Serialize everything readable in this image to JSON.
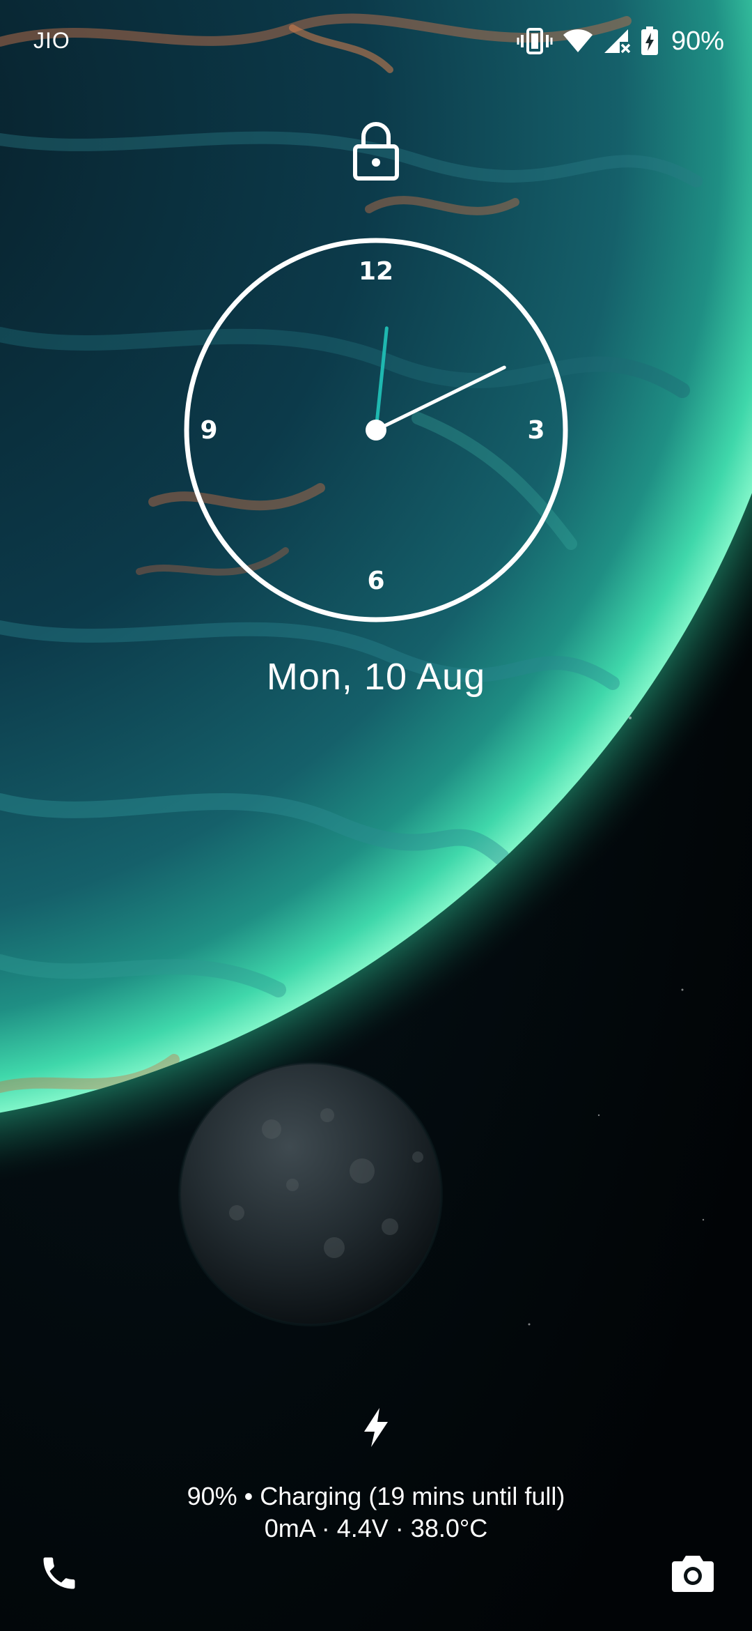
{
  "status_bar": {
    "carrier": "JIO",
    "battery_percent": "90%",
    "icons": [
      "vibrate-icon",
      "wifi-icon",
      "cellular-no-signal-icon",
      "battery-charging-icon"
    ]
  },
  "lock_screen": {
    "lock_icon": "lock-icon",
    "clock": {
      "numerals": {
        "twelve": "12",
        "three": "3",
        "six": "6",
        "nine": "9"
      },
      "hour_hand_angle_deg": 64,
      "minute_hand_angle_deg": 6,
      "minute_hand_color": "#1fb8b0"
    },
    "date": "Mon, 10 Aug",
    "charging": {
      "icon": "lightning-bolt-icon",
      "line1": "90% • Charging (19 mins until full)",
      "line2": "0mA · 4.4V · 38.0°C"
    },
    "shortcuts": {
      "left": "phone-icon",
      "right": "camera-icon"
    }
  },
  "colors": {
    "space_background": "#02080b",
    "planet_glow": "#3fe0b0",
    "planet_ocean": "#0f4a5a"
  }
}
